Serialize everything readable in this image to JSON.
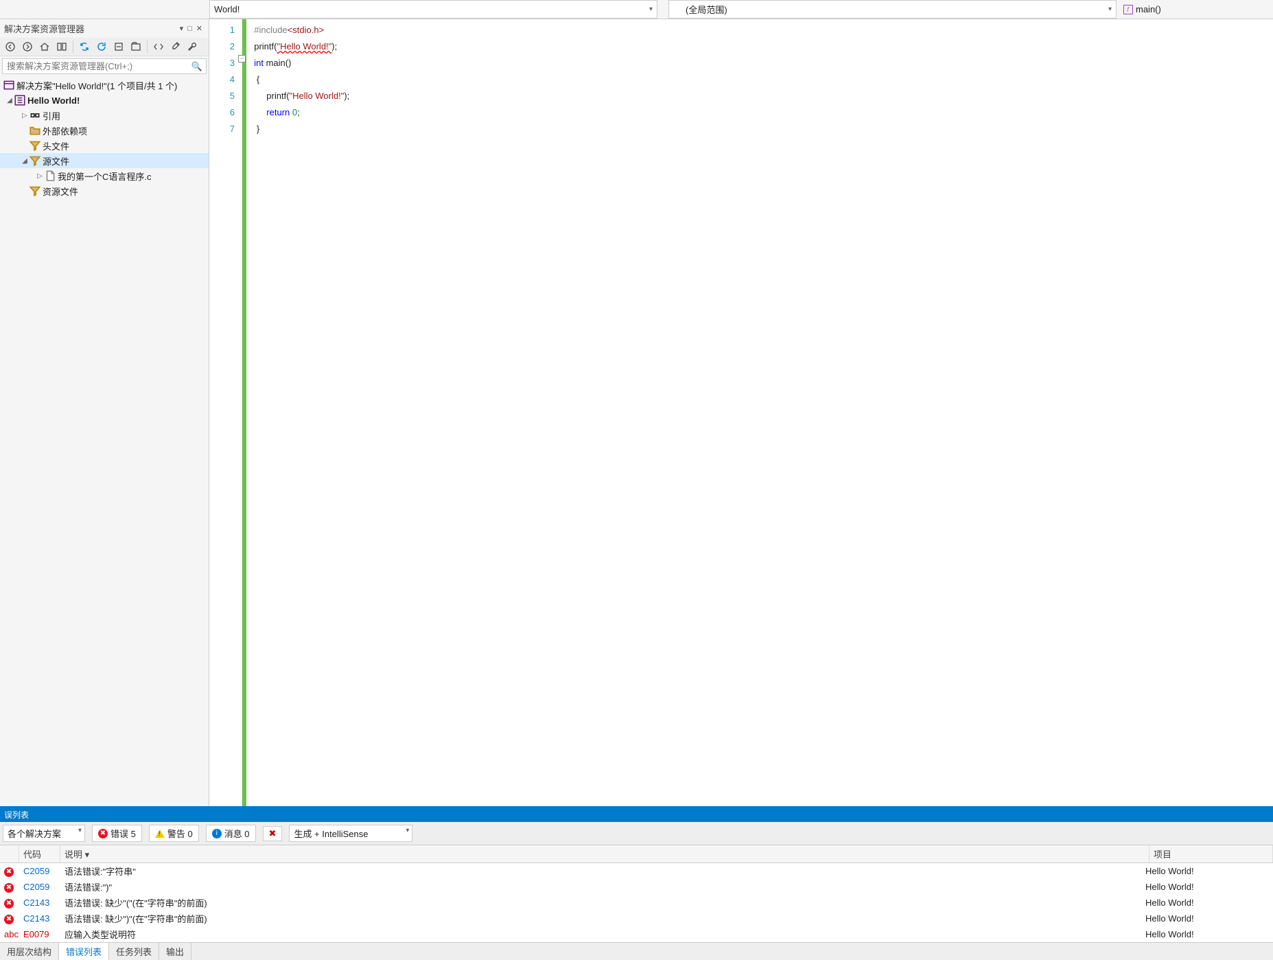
{
  "topbar": {
    "file_dd": "World!",
    "scope_dd": "(全局范围)",
    "func_dd": "main()"
  },
  "explorer": {
    "title": "解决方案资源管理器",
    "search_placeholder": "搜索解决方案资源管理器(Ctrl+;)",
    "solution": "解决方案\"Hello World!\"(1 个项目/共 1 个)",
    "project": "Hello World!",
    "nodes": {
      "refs": "引用",
      "ext": "外部依赖项",
      "hdr": "头文件",
      "src": "源文件",
      "file": "我的第一个C语言程序.c",
      "res": "资源文件"
    }
  },
  "editor": {
    "lines": [
      "1",
      "2",
      "3",
      "4",
      "5",
      "6",
      "7"
    ],
    "code": {
      "l1_pre": "#include",
      "l1_inc": "<stdio.h>",
      "l2_fn": "printf",
      "l2_p1": "(",
      "l2_str": "\"Hello World!\"",
      "l2_p2": ");",
      "l3_kw": "int",
      "l3_rest": " main()",
      "l4": "{",
      "l5_fn": "printf",
      "l5_p1": "(",
      "l5_str": "\"Hello World!\"",
      "l5_p2": ");",
      "l6_kw": "return",
      "l6_num": " 0",
      "l6_semi": ";",
      "l7": "}"
    }
  },
  "errpanel": {
    "caption": "误列表",
    "combo_scope": "各个解决方案",
    "err_label": "错误 5",
    "warn_label": "警告 0",
    "info_label": "消息 0",
    "combo_src": "生成 + IntelliSense",
    "cols": {
      "code": "代码",
      "desc": "说明",
      "proj": "项目"
    },
    "rows": [
      {
        "code": "C2059",
        "desc": "语法错误:\"字符串\"",
        "proj": "Hello World!"
      },
      {
        "code": "C2059",
        "desc": "语法错误:\")\"",
        "proj": "Hello World!"
      },
      {
        "code": "C2143",
        "desc": "语法错误: 缺少\"(\"(在\"字符串\"的前面)",
        "proj": "Hello World!"
      },
      {
        "code": "C2143",
        "desc": "语法错误: 缺少\")\"(在\"字符串\"的前面)",
        "proj": "Hello World!"
      },
      {
        "code": "E0079",
        "desc": "应输入类型说明符",
        "proj": "Hello World!"
      }
    ]
  },
  "bottom_tabs": {
    "t1": "用层次结构",
    "t2": "错误列表",
    "t3": "任务列表",
    "t4": "输出"
  }
}
